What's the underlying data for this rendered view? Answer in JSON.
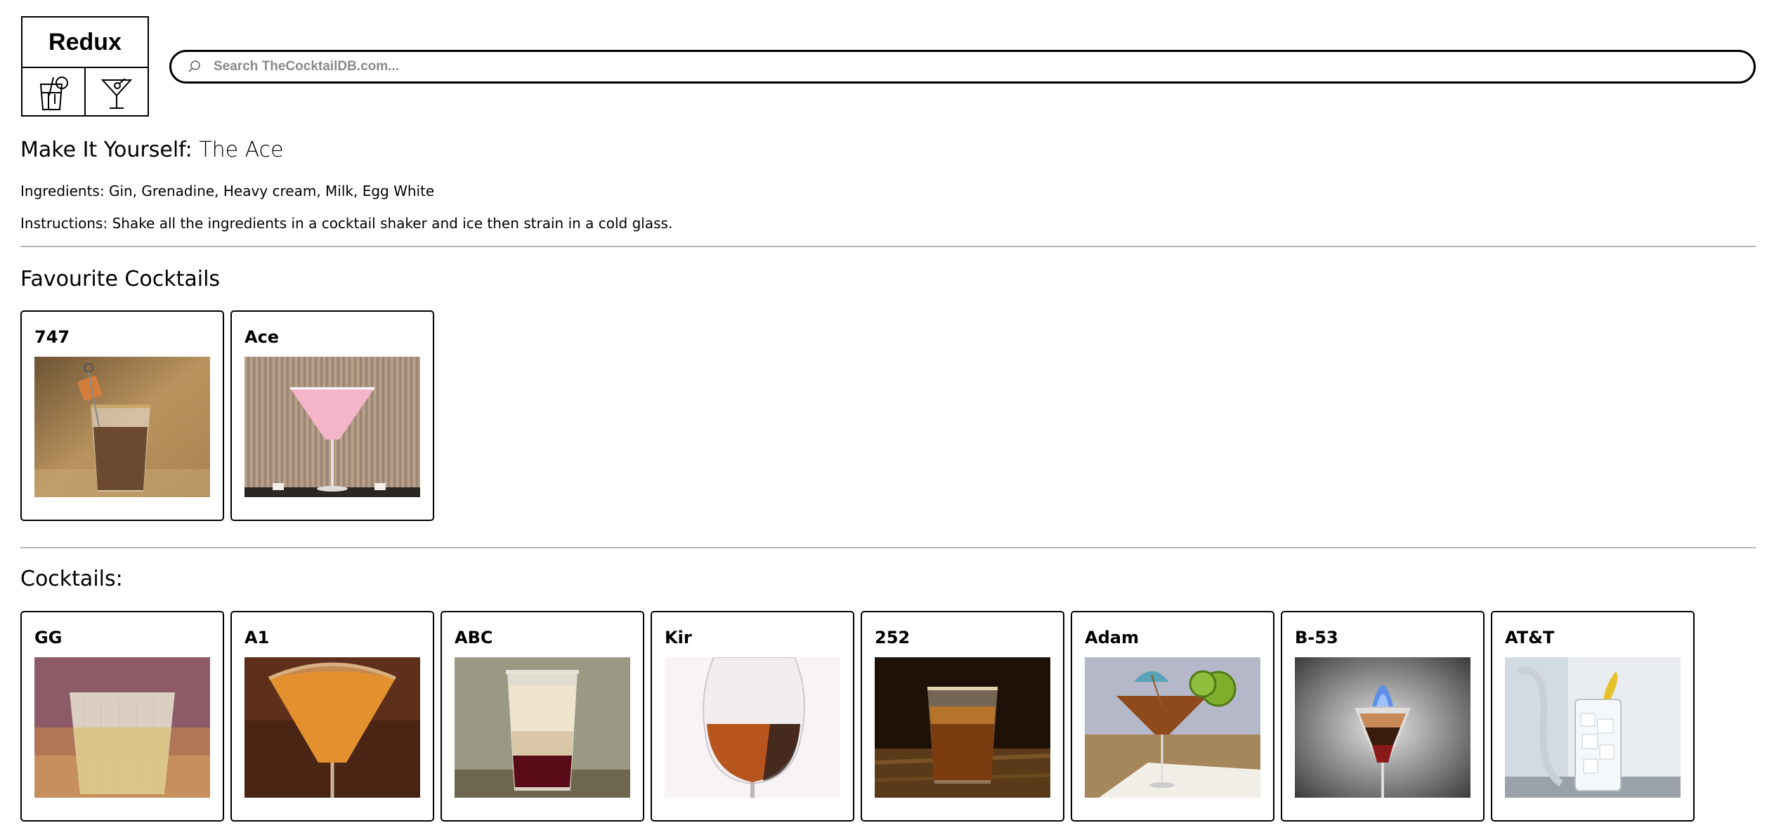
{
  "header": {
    "logo_text": "Redux",
    "search_placeholder": "Search TheCocktailDB.com..."
  },
  "icons": {
    "logo_left": "cocktail-glass-with-straw-icon",
    "logo_right": "martini-glass-icon",
    "search": "search-icon"
  },
  "make_it_yourself": {
    "label": "Make It Yourself:",
    "name": "The Ace",
    "ingredients_label": "Ingredients:",
    "ingredients": "Gin, Grenadine, Heavy cream, Milk, Egg White",
    "instructions_label": "Instructions:",
    "instructions": "Shake all the ingredients in a cocktail shaker and ice then strain in a cold glass."
  },
  "favourites": {
    "title": "Favourite Cocktails",
    "items": [
      {
        "name": "747",
        "image": "747-cocktail-photo"
      },
      {
        "name": "Ace",
        "image": "ace-cocktail-photo"
      }
    ]
  },
  "cocktails": {
    "title": "Cocktails:",
    "items": [
      {
        "name": "GG",
        "image": "gg-cocktail-photo"
      },
      {
        "name": "A1",
        "image": "a1-cocktail-photo"
      },
      {
        "name": "ABC",
        "image": "abc-cocktail-photo"
      },
      {
        "name": "Kir",
        "image": "kir-cocktail-photo"
      },
      {
        "name": "252",
        "image": "252-cocktail-photo"
      },
      {
        "name": "Adam",
        "image": "adam-cocktail-photo"
      },
      {
        "name": "B-53",
        "image": "b-53-cocktail-photo"
      },
      {
        "name": "AT&T",
        "image": "att-cocktail-photo"
      }
    ]
  }
}
